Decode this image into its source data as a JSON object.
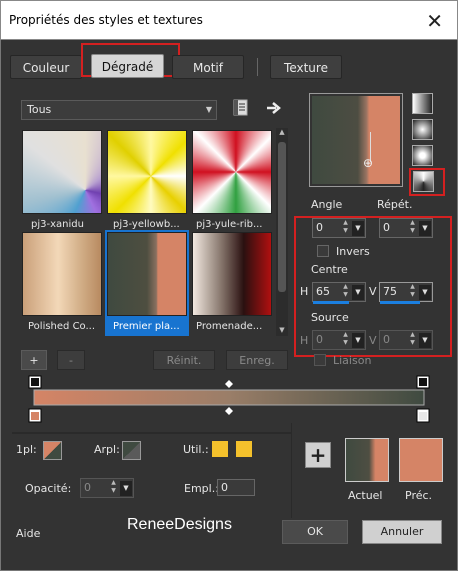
{
  "window": {
    "title": "Propriétés des styles et textures",
    "close": "✕"
  },
  "tabs": [
    {
      "label": "Couleur"
    },
    {
      "label": "Dégradé"
    },
    {
      "label": "Motif"
    },
    {
      "label": "Texture"
    }
  ],
  "library": {
    "category": "Tous",
    "gradients": [
      {
        "name": "pj3-xanidu"
      },
      {
        "name": "pj3-yellowb..."
      },
      {
        "name": "pj3-yule-rib..."
      },
      {
        "name": "Polished Co..."
      },
      {
        "name": "Premier pla..."
      },
      {
        "name": "Promenade..."
      }
    ]
  },
  "preview": {
    "point_marker": "⊕"
  },
  "angle": {
    "label": "Angle",
    "value": "0"
  },
  "repeat": {
    "label": "Répét.",
    "value": "0"
  },
  "invert": {
    "label": "Invers"
  },
  "centre": {
    "label": "Centre",
    "h_label": "H",
    "h_value": "65",
    "v_label": "V",
    "v_value": "75"
  },
  "source": {
    "label": "Source",
    "h_label": "H",
    "h_value": "0",
    "v_label": "V",
    "v_value": "0"
  },
  "link": {
    "label": "Liaison"
  },
  "editor_buttons": {
    "add": "+",
    "remove": "-",
    "reset": "Réinit.",
    "save": "Enreg."
  },
  "bottom": {
    "fg_label": "1pl:",
    "bg_label": "Arpl:",
    "util_label": "Util.:",
    "opacity_label": "Opacité:",
    "opacity_value": "0",
    "loc_label": "Empl.:",
    "loc_value": "0",
    "add_button": "+",
    "current_label": "Actuel",
    "previous_label": "Préc."
  },
  "footer": {
    "help": "Aide",
    "watermark": "ReneeDesigns",
    "ok": "OK",
    "cancel": "Annuler"
  },
  "colors": {
    "light": "#d58466",
    "dark": "#3f4a40",
    "accent": "#f4c12c",
    "selection": "#1874d0"
  }
}
